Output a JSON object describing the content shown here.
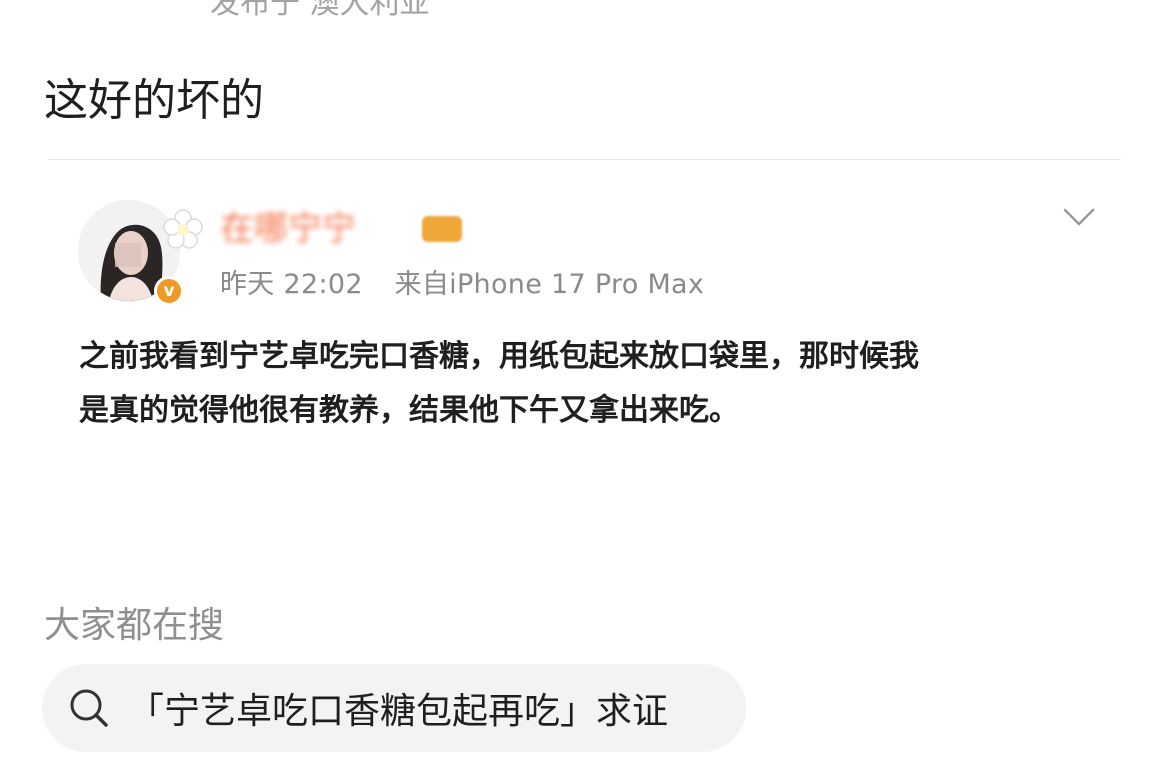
{
  "post": {
    "location": "发布于 澳大利亚",
    "caption": "这好的坏的"
  },
  "quoted": {
    "username": "在哪宁宁",
    "timestamp": "昨天 22:02",
    "source": "来自iPhone 17 Pro Max",
    "verified_mark": "v",
    "body_line1": "之前我看到宁艺卓吃完口香糖，用纸包起来放口袋里，那时候我",
    "body_line2": "是真的觉得他很有教养，结果他下午又拿出来吃。"
  },
  "trending": {
    "title": "大家都在搜",
    "query": "「宁艺卓吃口香糖包起再吃」求证"
  },
  "colors": {
    "verified": "#f09a26",
    "username": "#f25c2a",
    "meta": "#8a8a8a",
    "chip_bg": "#f3f3f3"
  },
  "icons": {
    "more": "chevron-down-icon",
    "search": "search-icon",
    "verified": "verified-badge-icon",
    "sticker": "flower-sticker-icon"
  }
}
